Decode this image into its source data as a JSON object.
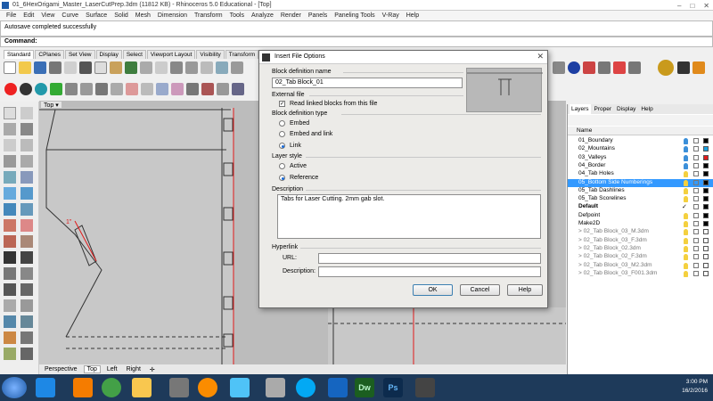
{
  "window": {
    "title": "01_6HexOrigami_Master_LaserCutPrep.3dm (11812 KB) - Rhinoceros 5.0 Educational - [Top]",
    "controls": [
      "–",
      "□",
      "✕"
    ]
  },
  "menu": [
    "File",
    "Edit",
    "View",
    "Curve",
    "Surface",
    "Solid",
    "Mesh",
    "Dimension",
    "Transform",
    "Tools",
    "Analyze",
    "Render",
    "Panels",
    "Paneling Tools",
    "V-Ray",
    "Help"
  ],
  "command": {
    "history": "Autosave completed successfully",
    "prompt": "Command:"
  },
  "toolbar_tabs": [
    "Standard",
    "CPlanes",
    "Set View",
    "Display",
    "Select",
    "Viewport Layout",
    "Visibility",
    "Transform"
  ],
  "viewport": {
    "name": "Top",
    "tabs": [
      "Perspective",
      "Top",
      "Left",
      "Right"
    ],
    "active_tab": "Top",
    "add_tab_icon": "✛",
    "label_1": "1\"",
    "label_2": "1\""
  },
  "layers_panel": {
    "tabs": [
      "Layers",
      "Proper",
      "Display",
      "Help"
    ],
    "column_header": "Name",
    "layers": [
      {
        "name": "01_Boundary",
        "bulb": "blue",
        "swatch": "#000000"
      },
      {
        "name": "02_Mountains",
        "bulb": "blue",
        "swatch": "#1aa0e0"
      },
      {
        "name": "03_Valleys",
        "bulb": "blue",
        "swatch": "#e21a1a"
      },
      {
        "name": "04_Border",
        "bulb": "blue",
        "swatch": "#000000"
      },
      {
        "name": "04_Tab Holes",
        "bulb": "yellow",
        "swatch": "#000000"
      },
      {
        "name": "05_Bottom Side Numberings",
        "bulb": "yellow",
        "swatch": "#000000",
        "selected": true
      },
      {
        "name": "05_Tab Dashlines",
        "bulb": "yellow",
        "swatch": "#000000"
      },
      {
        "name": "05_Tab Scorelines",
        "bulb": "yellow",
        "swatch": "#000000"
      },
      {
        "name": "Default",
        "bulb": "none",
        "swatch": "#000000",
        "bold": true,
        "check": "✓"
      },
      {
        "name": "Defpoint",
        "bulb": "yellow",
        "swatch": "#000000"
      },
      {
        "name": "Make2D",
        "bulb": "yellow",
        "swatch": "#000000"
      },
      {
        "name": "> 02_Tab Block_03_M.3dm",
        "bulb": "yellow",
        "swatch": "#ffffff",
        "sub": true
      },
      {
        "name": "> 02_Tab Block_03_F.3dm",
        "bulb": "yellow",
        "swatch": "#ffffff",
        "sub": true
      },
      {
        "name": "> 02_Tab Block_02.3dm",
        "bulb": "yellow",
        "swatch": "#ffffff",
        "sub": true
      },
      {
        "name": "> 02_Tab Block_02_F.3dm",
        "bulb": "yellow",
        "swatch": "#ffffff",
        "sub": true
      },
      {
        "name": "> 02_Tab Block_03_M2.3dm",
        "bulb": "yellow",
        "swatch": "#ffffff",
        "sub": true
      },
      {
        "name": "> 02_Tab Block_03_F001.3dm",
        "bulb": "yellow",
        "swatch": "#ffffff",
        "sub": true
      }
    ]
  },
  "dialog": {
    "title": "Insert File Options",
    "close": "✕",
    "block_definition_name_label": "Block definition name",
    "block_definition_name": "02_Tab Block_01",
    "external_file_label": "External file",
    "read_linked_label": "Read linked blocks from this file",
    "read_linked_checked": true,
    "check_mark": "✓",
    "block_definition_type_label": "Block definition type",
    "type_options": [
      "Embed",
      "Embed and link",
      "Link"
    ],
    "type_selected": "Link",
    "layer_style_label": "Layer style",
    "layer_options": [
      "Active",
      "Reference"
    ],
    "layer_selected": "Reference",
    "description_label": "Description",
    "description": "Tabs for Laser Cutting. 2mm gab slot.",
    "hyperlink_label": "Hyperlink",
    "url_label": "URL:",
    "url_value": "",
    "hyperlink_description_label": "Description:",
    "hyperlink_description_value": "",
    "ok_label": "OK",
    "cancel_label": "Cancel",
    "help_label": "Help"
  },
  "taskbar": {
    "time": "3:00 PM",
    "date": "16/2/2016",
    "apps": [
      {
        "name": "Internet Explorer",
        "icon": "internet-explorer-icon"
      },
      {
        "name": "Firefox",
        "icon": "firefox-icon"
      },
      {
        "name": "Chrome",
        "icon": "chrome-icon"
      },
      {
        "name": "File Explorer",
        "icon": "file-explorer-icon"
      },
      {
        "name": "Media Player",
        "icon": "media-player-icon"
      },
      {
        "name": "Paint",
        "icon": "paint-icon"
      },
      {
        "name": "Tools",
        "icon": "tools-icon"
      },
      {
        "name": "Skype",
        "icon": "skype-icon"
      },
      {
        "name": "Word",
        "icon": "word-icon"
      },
      {
        "name": "Dreamweaver",
        "icon": "dreamweaver-icon",
        "label": "Dw"
      },
      {
        "name": "Photoshop",
        "icon": "photoshop-icon",
        "label": "Ps"
      },
      {
        "name": "Rhino",
        "icon": "rhino-icon"
      }
    ]
  },
  "colors": {
    "accent": "#3399ff",
    "taskbar": "#1e3a5a",
    "curve_red": "#e21a1a"
  }
}
